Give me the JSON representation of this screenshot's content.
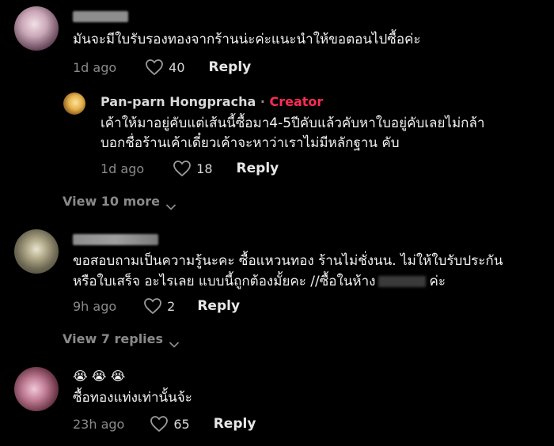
{
  "comments": [
    {
      "text": "มันจะมีใบรับรองทองจากร้านน่ะค่ะแนะนำให้ขอตอนไปซื้อค่ะ",
      "time": "1d ago",
      "likes": "40",
      "reply_label": "Reply"
    },
    {
      "line1": "ขอสอบถามเป็นความรู้นะคะ ซื้อแหวนทอง ร้านไม่ชั่งนน. ไม่ให้ใบรับประกัน",
      "line2_before": "หรือใบเสร็จ อะไรเลย แบบนี้ถูกต้องมั้ยคะ //ซื้อในห้าง",
      "line2_after": "ค่ะ",
      "time": "9h ago",
      "likes": "2",
      "reply_label": "Reply"
    },
    {
      "emoji": "😭 😭 😭",
      "text": "ซื้อทองแท่งเท่านั้นจ้ะ",
      "time": "23h ago",
      "likes": "65",
      "reply_label": "Reply"
    }
  ],
  "creator_reply": {
    "name": "Pan-parn Hongpracha",
    "separator": " · ",
    "badge": "Creator",
    "line1": "เค้าให้มาอยู่คับแต่เส้นนี้ซื้อมา4-5ปีคับแล้วคับหาใบอยู่คับเลยไม่กล้า",
    "line2": "บอกชื่อร้านเค้าเดี๋ยวเค้าจะหาว่าเราไม่มีหลักฐาน คับ",
    "time": "1d ago",
    "likes": "18",
    "reply_label": "Reply"
  },
  "view_more": [
    {
      "label": "View 10 more"
    },
    {
      "label": "View 7 replies"
    }
  ],
  "colors": {
    "background": "#000000",
    "creator_badge": "#fe2c55",
    "meta_text": "#8a8a8a"
  }
}
